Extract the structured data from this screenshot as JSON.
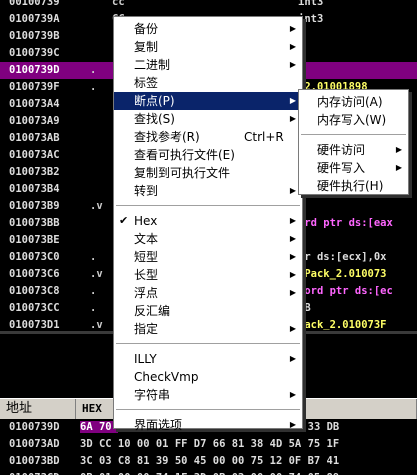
{
  "disasm": {
    "rows": [
      {
        "addr": "00100739",
        "mark": "",
        "hex": "cc",
        "asm": "int3",
        "selected": false
      },
      {
        "addr": "0100739A",
        "mark": "",
        "hex": "CC",
        "asm": "int3",
        "selected": false
      },
      {
        "addr": "0100739B",
        "mark": "",
        "hex": "",
        "asm": "",
        "selected": false
      },
      {
        "addr": "0100739C",
        "mark": "",
        "hex": "",
        "asm": "",
        "selected": false
      },
      {
        "addr": "0100739D",
        "mark": ".",
        "hex": "",
        "asm": "",
        "selected": true
      },
      {
        "addr": "0100739F",
        "mark": ".",
        "hex": "",
        "asm": "_2.01001898",
        "selected": false
      },
      {
        "addr": "010073A4",
        "mark": "",
        "hex": "",
        "asm": "",
        "selected": false
      },
      {
        "addr": "010073A9",
        "mark": "",
        "hex": "",
        "asm": "",
        "selected": false
      },
      {
        "addr": "010073AB",
        "mark": "",
        "hex": "",
        "asm": "",
        "selected": false
      },
      {
        "addr": "010073AC",
        "mark": "",
        "hex": "",
        "asm": "",
        "selected": false
      },
      {
        "addr": "010073B2",
        "mark": "",
        "hex": "",
        "asm": "",
        "selected": false
      },
      {
        "addr": "010073B4",
        "mark": "",
        "hex": "",
        "asm": "",
        "selected": false
      },
      {
        "addr": "010073B9",
        "mark": ".v",
        "hex": "",
        "asm": "",
        "selected": false
      },
      {
        "addr": "010073BB",
        "mark": "",
        "hex": "",
        "asm": "ord ptr ds:[eax",
        "selected": false
      },
      {
        "addr": "010073BE",
        "mark": "",
        "hex": "",
        "asm": "",
        "selected": false
      },
      {
        "addr": "010073C0",
        "mark": ".",
        "hex": "",
        "asm": "tr ds:[ecx],0x",
        "selected": false
      },
      {
        "addr": "010073C6",
        "mark": ".v",
        "hex": "",
        "asm": "SPack_2.010073",
        "selected": false
      },
      {
        "addr": "010073C8",
        "mark": ".",
        "hex": "",
        "asm": "word ptr ds:[ec",
        "selected": false
      },
      {
        "addr": "010073CC",
        "mark": ".",
        "hex": "",
        "asm": "0B",
        "selected": false
      },
      {
        "addr": "010073D1",
        "mark": ".v",
        "hex": "",
        "asm": "Pack_2.010073F",
        "selected": false
      },
      {
        "addr": "010073D3",
        "mark": ".",
        "hex": "",
        "asm": "0B",
        "selected": false
      }
    ]
  },
  "dump": {
    "headers": {
      "address": "地址",
      "hex": "HEX"
    },
    "rows": [
      {
        "addr": "0100739D",
        "bytes": "6A 70 68 98 18 00 01 E8 BF 01 00 00 33 DB",
        "highlight_count": 2
      },
      {
        "addr": "010073AD",
        "bytes": "3D CC 10 00 01 FF D7 66 81 38 4D 5A 75 1F",
        "highlight_count": 0
      },
      {
        "addr": "010073BD",
        "bytes": "3C 03 C8 81 39 50 45 00 00 75 12 0F B7 41",
        "highlight_count": 0
      },
      {
        "addr": "010073CD",
        "bytes": "0B 01 00 00 74 1F 3D 0B 02 00 00 74 05 89",
        "highlight_count": 0
      }
    ]
  },
  "context_menu": {
    "items": [
      {
        "type": "item",
        "label": "备份",
        "submenu": true
      },
      {
        "type": "item",
        "label": "复制",
        "submenu": true
      },
      {
        "type": "item",
        "label": "二进制",
        "submenu": true
      },
      {
        "type": "item",
        "label": "标签",
        "submenu": false
      },
      {
        "type": "item",
        "label": "断点(P)",
        "submenu": true,
        "active": true
      },
      {
        "type": "item",
        "label": "查找(S)",
        "submenu": true
      },
      {
        "type": "item",
        "label": "查找参考(R)",
        "shortcut": "Ctrl+R",
        "submenu": false
      },
      {
        "type": "item",
        "label": "查看可执行文件(E)",
        "submenu": false
      },
      {
        "type": "item",
        "label": "复制到可执行文件",
        "submenu": false
      },
      {
        "type": "item",
        "label": "转到",
        "submenu": true
      },
      {
        "type": "sep"
      },
      {
        "type": "item",
        "label": "Hex",
        "submenu": true,
        "checked": true
      },
      {
        "type": "item",
        "label": "文本",
        "submenu": true
      },
      {
        "type": "item",
        "label": "短型",
        "submenu": true
      },
      {
        "type": "item",
        "label": "长型",
        "submenu": true
      },
      {
        "type": "item",
        "label": "浮点",
        "submenu": true
      },
      {
        "type": "item",
        "label": "反汇编",
        "submenu": false
      },
      {
        "type": "item",
        "label": "指定",
        "submenu": true
      },
      {
        "type": "sep"
      },
      {
        "type": "item",
        "label": "ILLY",
        "submenu": true
      },
      {
        "type": "item",
        "label": "CheckVmp",
        "submenu": false
      },
      {
        "type": "item",
        "label": "字符串",
        "submenu": true
      },
      {
        "type": "sep"
      },
      {
        "type": "item",
        "label": "界面选项",
        "submenu": true
      }
    ]
  },
  "breakpoint_submenu": {
    "items": [
      {
        "type": "item",
        "label": "内存访问(A)",
        "submenu": false
      },
      {
        "type": "item",
        "label": "内存写入(W)",
        "submenu": false
      },
      {
        "type": "sep"
      },
      {
        "type": "item",
        "label": "硬件访问",
        "submenu": true
      },
      {
        "type": "item",
        "label": "硬件写入",
        "submenu": true
      },
      {
        "type": "item",
        "label": "硬件执行(H)",
        "submenu": false
      }
    ]
  },
  "colors": {
    "selection": "#800080",
    "menu_highlight": "#0a246a",
    "asm_text": "#ffff66",
    "keyword_text": "#ff66ff"
  }
}
